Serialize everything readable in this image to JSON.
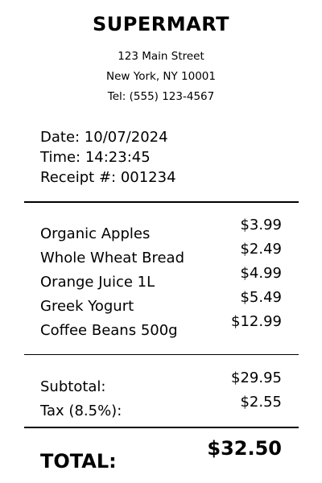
{
  "store": {
    "name": "SUPERMART",
    "address": "123 Main Street",
    "city": "New York, NY 10001",
    "phone": "Tel: (555) 123-4567"
  },
  "meta": {
    "date": "Date: 10/07/2024",
    "time": "Time: 14:23:45",
    "receipt": "Receipt #: 001234"
  },
  "items": [
    {
      "name": "Organic Apples",
      "price": "$3.99"
    },
    {
      "name": "Whole Wheat Bread",
      "price": "$2.49"
    },
    {
      "name": "Orange Juice 1L",
      "price": "$4.99"
    },
    {
      "name": "Greek Yogurt",
      "price": "$5.49"
    },
    {
      "name": "Coffee Beans 500g",
      "price": "$12.99"
    }
  ],
  "summary": {
    "subtotal_label": "Subtotal:",
    "subtotal_value": "$29.95",
    "tax_label": "Tax (8.5%):",
    "tax_value": "$2.55"
  },
  "total": {
    "label": "TOTAL:",
    "value": "$32.50"
  }
}
